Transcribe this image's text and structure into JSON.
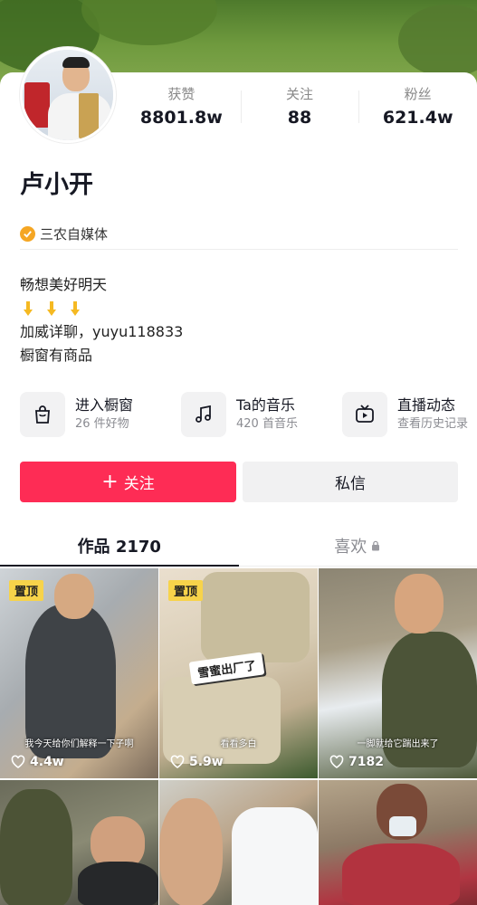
{
  "profile": {
    "name": "卢小开",
    "stats": [
      {
        "label": "获赞",
        "value": "8801.8w"
      },
      {
        "label": "关注",
        "value": "88"
      },
      {
        "label": "粉丝",
        "value": "621.4w"
      }
    ],
    "tag": "三农自媒体",
    "bio": [
      "畅想美好明天",
      "加威详聊，yuyu118833",
      "橱窗有商品"
    ]
  },
  "shortcuts": [
    {
      "title": "进入橱窗",
      "sub": "26 件好物",
      "icon": "shopping-bag-icon"
    },
    {
      "title": "Ta的音乐",
      "sub": "420 首音乐",
      "icon": "music-note-icon"
    },
    {
      "title": "直播动态",
      "sub": "查看历史记录",
      "icon": "tv-icon"
    }
  ],
  "actions": {
    "follow": "关注",
    "follow_icon": "+",
    "message": "私信"
  },
  "tabs": {
    "works": "作品 2170",
    "likes": "喜欢"
  },
  "videos": [
    {
      "pinned": "置顶",
      "likes": "4.4w",
      "caption": "我今天给你们解释一下子啊"
    },
    {
      "pinned": "置顶",
      "likes": "5.9w",
      "caption": "看看多白",
      "sticker": "雪蜜出厂了"
    },
    {
      "pinned": "",
      "likes": "7182",
      "caption": "一脚就给它踹出来了"
    },
    {
      "pinned": "",
      "likes": "",
      "caption": ""
    },
    {
      "pinned": "",
      "likes": "",
      "caption": ""
    },
    {
      "pinned": "",
      "likes": "",
      "caption": ""
    }
  ],
  "colors": {
    "accent": "#fe2c55",
    "pin": "#f7d34a",
    "verify": "#f5a623"
  }
}
